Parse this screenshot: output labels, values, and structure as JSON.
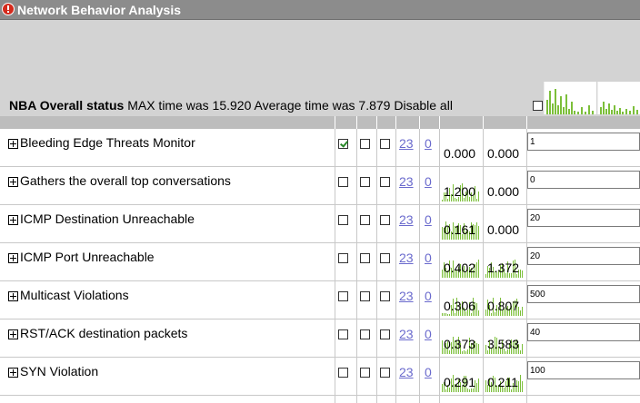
{
  "window": {
    "title": "Network Behavior Analysis"
  },
  "status": {
    "label": "NBA Overall status",
    "max_text": "MAX time was 15.920",
    "avg_text": "Average time was 7.879",
    "disable_all": "Disable all",
    "disable_all_checked": false
  },
  "rows": [
    {
      "name": "Bleeding Edge Threats Monitor",
      "cb1": true,
      "cb2": false,
      "cb3": false,
      "link1": "23",
      "link2": "0",
      "v1": "0.000",
      "v2": "0.000",
      "input": "1",
      "spark1": false,
      "spark2": false
    },
    {
      "name": "Gathers the overall top conversations",
      "cb1": false,
      "cb2": false,
      "cb3": false,
      "link1": "23",
      "link2": "0",
      "v1": "1.200",
      "v2": "0.000",
      "input": "0",
      "spark1": true,
      "spark2": false
    },
    {
      "name": "ICMP Destination Unreachable",
      "cb1": false,
      "cb2": false,
      "cb3": false,
      "link1": "23",
      "link2": "0",
      "v1": "0.161",
      "v2": "0.000",
      "input": "20",
      "spark1": true,
      "spark2": false
    },
    {
      "name": "ICMP Port Unreachable",
      "cb1": false,
      "cb2": false,
      "cb3": false,
      "link1": "23",
      "link2": "0",
      "v1": "0.402",
      "v2": "1.372",
      "input": "20",
      "spark1": true,
      "spark2": true
    },
    {
      "name": "Multicast Violations",
      "cb1": false,
      "cb2": false,
      "cb3": false,
      "link1": "23",
      "link2": "0",
      "v1": "0.306",
      "v2": "0.807",
      "input": "500",
      "spark1": true,
      "spark2": true
    },
    {
      "name": "RST/ACK destination packets",
      "cb1": false,
      "cb2": false,
      "cb3": false,
      "link1": "23",
      "link2": "0",
      "v1": "0.373",
      "v2": "3.583",
      "input": "40",
      "spark1": true,
      "spark2": true
    },
    {
      "name": "SYN Violation",
      "cb1": false,
      "cb2": false,
      "cb3": false,
      "link1": "23",
      "link2": "0",
      "v1": "0.291",
      "v2": "0.211",
      "input": "100",
      "spark1": true,
      "spark2": true
    }
  ],
  "colors": {
    "titlebar": "#8c8c8c",
    "header_band": "#d3d3d3",
    "spark": "#7cbf3a",
    "link": "#6a6acd"
  }
}
